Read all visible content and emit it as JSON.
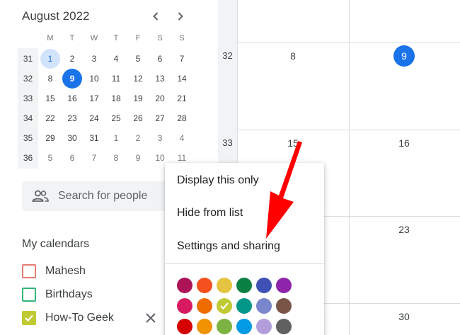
{
  "mini_calendar": {
    "title": "August 2022",
    "prev_icon": "chevron-left-icon",
    "next_icon": "chevron-right-icon",
    "weekdays": [
      "M",
      "T",
      "W",
      "T",
      "F",
      "S",
      "S"
    ],
    "weeks": [
      {
        "number": "31",
        "days": [
          {
            "d": "1",
            "state": "selected"
          },
          {
            "d": "2"
          },
          {
            "d": "3"
          },
          {
            "d": "4"
          },
          {
            "d": "5"
          },
          {
            "d": "6"
          },
          {
            "d": "7"
          }
        ]
      },
      {
        "number": "32",
        "days": [
          {
            "d": "8"
          },
          {
            "d": "9",
            "state": "today"
          },
          {
            "d": "10"
          },
          {
            "d": "11"
          },
          {
            "d": "12"
          },
          {
            "d": "13"
          },
          {
            "d": "14"
          }
        ]
      },
      {
        "number": "33",
        "days": [
          {
            "d": "15"
          },
          {
            "d": "16"
          },
          {
            "d": "17"
          },
          {
            "d": "18"
          },
          {
            "d": "19"
          },
          {
            "d": "20"
          },
          {
            "d": "21"
          }
        ]
      },
      {
        "number": "34",
        "days": [
          {
            "d": "22"
          },
          {
            "d": "23"
          },
          {
            "d": "24"
          },
          {
            "d": "25"
          },
          {
            "d": "26"
          },
          {
            "d": "27"
          },
          {
            "d": "28"
          }
        ]
      },
      {
        "number": "35",
        "days": [
          {
            "d": "29"
          },
          {
            "d": "30"
          },
          {
            "d": "31"
          },
          {
            "d": "1",
            "state": "other"
          },
          {
            "d": "2",
            "state": "other"
          },
          {
            "d": "3",
            "state": "other"
          },
          {
            "d": "4",
            "state": "other"
          }
        ]
      },
      {
        "number": "36",
        "days": [
          {
            "d": "5",
            "state": "other"
          },
          {
            "d": "6",
            "state": "other"
          },
          {
            "d": "7",
            "state": "other"
          },
          {
            "d": "8",
            "state": "other"
          },
          {
            "d": "9",
            "state": "other"
          },
          {
            "d": "10",
            "state": "other"
          },
          {
            "d": "11",
            "state": "other"
          }
        ]
      }
    ]
  },
  "search": {
    "placeholder": "Search for people",
    "icon": "people-icon"
  },
  "my_calendars": {
    "title": "My calendars",
    "items": [
      {
        "label": "Mahesh",
        "color": "#e67c73",
        "checked": false
      },
      {
        "label": "Birthdays",
        "color": "#33b679",
        "checked": false
      },
      {
        "label": "How-To Geek",
        "color": "#c0ca33",
        "checked": true
      }
    ],
    "remove_icon": "close-icon"
  },
  "main_grid": {
    "weeks": [
      {
        "number": "32",
        "days": [
          "8",
          "9"
        ],
        "today_index": 1
      },
      {
        "number": "33",
        "days": [
          "15",
          "16"
        ]
      },
      {
        "number": "",
        "days": [
          "",
          "23"
        ]
      },
      {
        "number": "",
        "days": [
          "",
          "30"
        ]
      }
    ]
  },
  "context_menu": {
    "items": [
      "Display this only",
      "Hide from list",
      "Settings and sharing"
    ],
    "colors": [
      "#ad1457",
      "#f4511e",
      "#e4c441",
      "#0b8043",
      "#3f51b5",
      "#8e24aa",
      "#d81b60",
      "#ef6c00",
      "#c0ca33",
      "#009688",
      "#7986cb",
      "#795548",
      "#d50000",
      "#f09300",
      "#7cb342",
      "#039be5",
      "#b39ddb",
      "#616161"
    ],
    "selected_color": "#c0ca33"
  },
  "annotation": {
    "arrow_color": "#ff0000"
  }
}
